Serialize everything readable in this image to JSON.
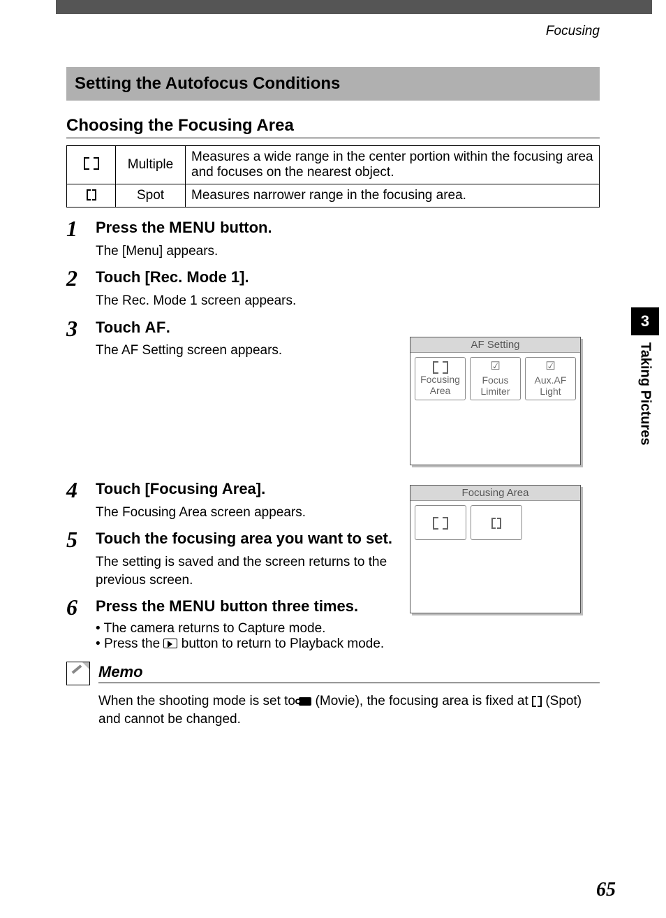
{
  "header_context": "Focusing",
  "section_banner": "Setting the Autofocus Conditions",
  "sub_heading": "Choosing the Focusing Area",
  "modes": [
    {
      "name": "Multiple",
      "desc": "Measures a wide range in the center portion within the focusing area and focuses on the nearest object."
    },
    {
      "name": "Spot",
      "desc": "Measures narrower range in the focusing area."
    }
  ],
  "steps": {
    "s1": {
      "title_pre": "Press the ",
      "title_word": "MENU",
      "title_post": " button.",
      "desc": "The [Menu] appears."
    },
    "s2": {
      "title": "Touch [Rec. Mode 1].",
      "desc": "The Rec. Mode 1 screen appears."
    },
    "s3": {
      "title_pre": "Touch ",
      "title_word": "AF",
      "title_post": ".",
      "desc": "The AF Setting screen appears."
    },
    "s4": {
      "title": "Touch [Focusing Area].",
      "desc": "The Focusing Area screen appears."
    },
    "s5": {
      "title": "Touch the focusing area you want to set.",
      "desc": "The setting is saved and the screen returns to the previous screen."
    },
    "s6": {
      "title_pre": "Press the ",
      "title_word": "MENU",
      "title_post": " button three times.",
      "bullets": [
        "The camera returns to Capture mode.",
        "Press the |PLAY| button to return to Playback mode."
      ]
    }
  },
  "memo": {
    "label": "Memo",
    "text_pre": "When the shooting mode is set to ",
    "text_mid": " (Movie), the focusing area is fixed at ",
    "text_post": " (Spot) and cannot be changed."
  },
  "side": {
    "chapter": "3",
    "label": "Taking Pictures"
  },
  "page_number": "65",
  "screen1": {
    "title": "AF Setting",
    "buttons": [
      {
        "label1": "Focusing",
        "label2": "Area",
        "icon": "bracket"
      },
      {
        "label1": "Focus",
        "label2": "Limiter",
        "icon": "check"
      },
      {
        "label1": "Aux.AF",
        "label2": "Light",
        "icon": "check"
      }
    ]
  },
  "screen2": {
    "title": "Focusing Area"
  }
}
